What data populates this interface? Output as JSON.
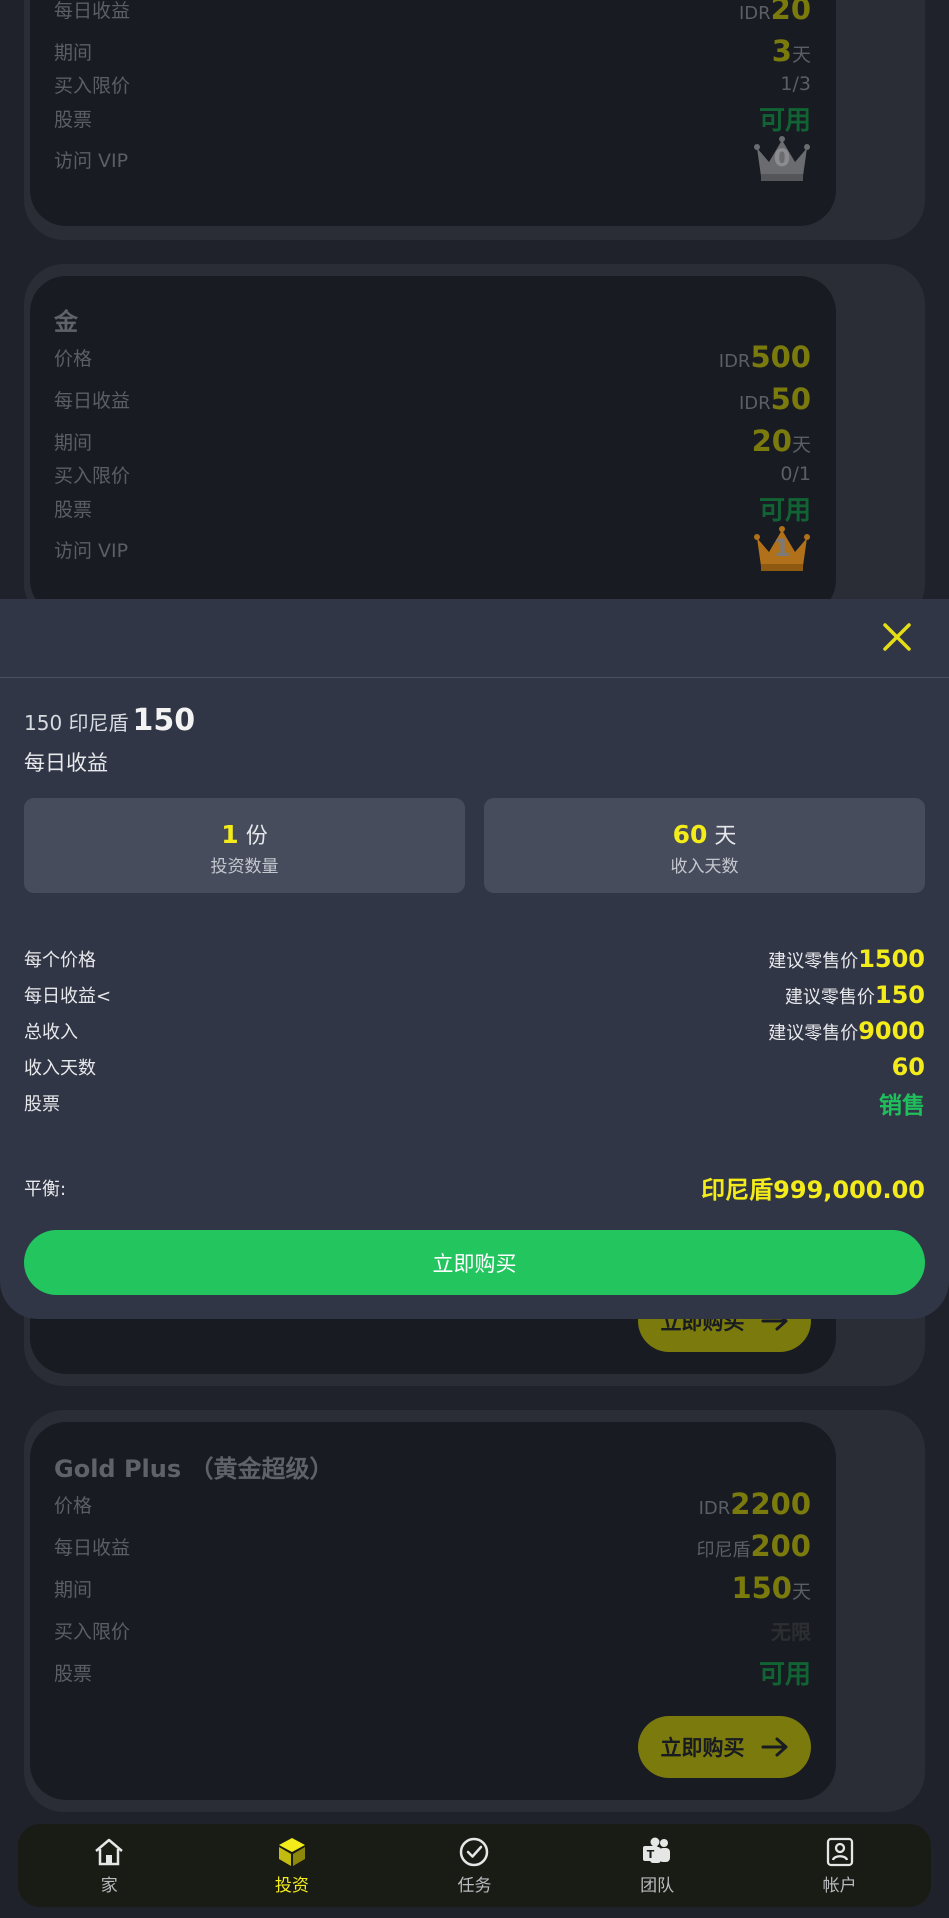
{
  "card_top": {
    "rows": [
      {
        "label": "每日收益",
        "prefix": "IDR",
        "value": "20"
      },
      {
        "label": "期间",
        "value": "3",
        "unit": "天"
      },
      {
        "label": "买入限价",
        "value": "1/3"
      },
      {
        "label": "股票",
        "value": "可用"
      },
      {
        "label": "访问 VIP",
        "vip": "0"
      }
    ]
  },
  "card_gold": {
    "title": "金",
    "price_label": "价格",
    "price_prefix": "IDR",
    "price_value": "500",
    "daily_label": "每日收益",
    "daily_prefix": "IDR",
    "daily_value": "50",
    "period_label": "期间",
    "period_value": "20",
    "period_unit": "天",
    "limit_label": "买入限价",
    "limit_value": "0/1",
    "stock_label": "股票",
    "stock_value": "可用",
    "vip_label": "访问 VIP",
    "vip_value": "1"
  },
  "card_partial": {
    "buy_label": "立即购买"
  },
  "card_goldplus": {
    "title": "Gold Plus （黄金超级）",
    "price_label": "价格",
    "price_prefix": "IDR",
    "price_value": "2200",
    "daily_label": "每日收益",
    "daily_prefix": "印尼盾",
    "daily_value": "200",
    "period_label": "期间",
    "period_value": "150",
    "period_unit": "天",
    "limit_label": "买入限价",
    "limit_value": "无限",
    "stock_label": "股票",
    "stock_value": "可用",
    "buy_label": "立即购买"
  },
  "modal": {
    "headline_prefix": "150 印尼盾",
    "headline_value": "150",
    "subtitle": "每日收益",
    "qty_value": "1",
    "qty_unit": "份",
    "qty_label": "投资数量",
    "days_value": "60",
    "days_unit": "天",
    "days_label": "收入天数",
    "details": [
      {
        "label": "每个价格",
        "prefix": "建议零售价",
        "value": "1500"
      },
      {
        "label": "每日收益<",
        "prefix": "建议零售价",
        "value": "150"
      },
      {
        "label": "总收入",
        "prefix": "建议零售价",
        "value": "9000"
      },
      {
        "label": "收入天数",
        "prefix": "",
        "value": "60"
      }
    ],
    "stock_label": "股票",
    "stock_value": "销售",
    "balance_label": "平衡:",
    "balance_value": "印尼盾999,000.00",
    "buy_button": "立即购买"
  },
  "nav": [
    {
      "label": "家",
      "icon": "home-icon"
    },
    {
      "label": "投资",
      "icon": "cube-icon",
      "active": true
    },
    {
      "label": "任务",
      "icon": "check-circle-icon"
    },
    {
      "label": "团队",
      "icon": "team-icon"
    },
    {
      "label": "帐户",
      "icon": "account-icon"
    }
  ],
  "colors": {
    "accent_yellow": "#f3ec1a",
    "green": "#22c55e",
    "sheet_bg": "#313646",
    "page_bg": "#1f222b"
  }
}
